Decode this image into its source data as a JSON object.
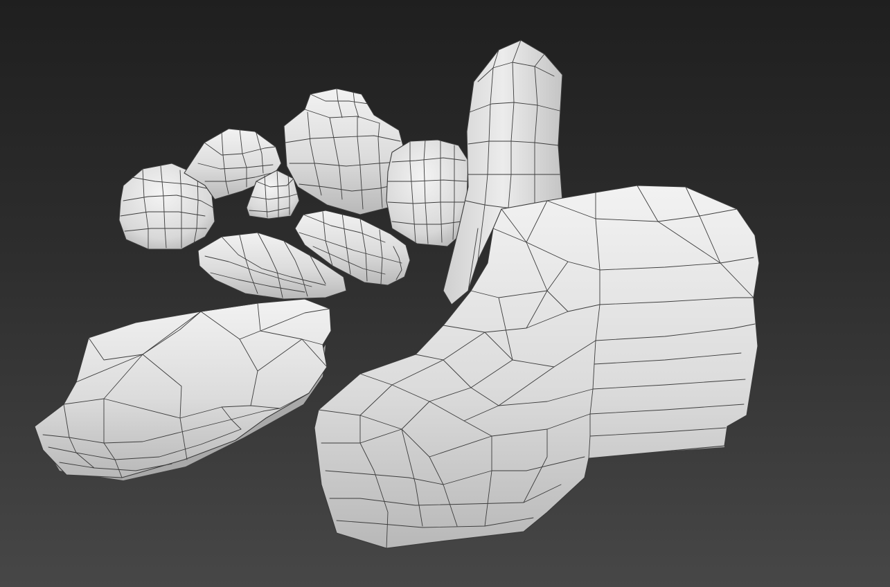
{
  "scene": {
    "background_top": "#1f1f1f",
    "background_bottom": "#474747",
    "rock_light": "#ededed",
    "rock_mid": "#d3d3d3",
    "rock_dark": "#a9a9a9",
    "wire_color": "#3b3b3b"
  }
}
